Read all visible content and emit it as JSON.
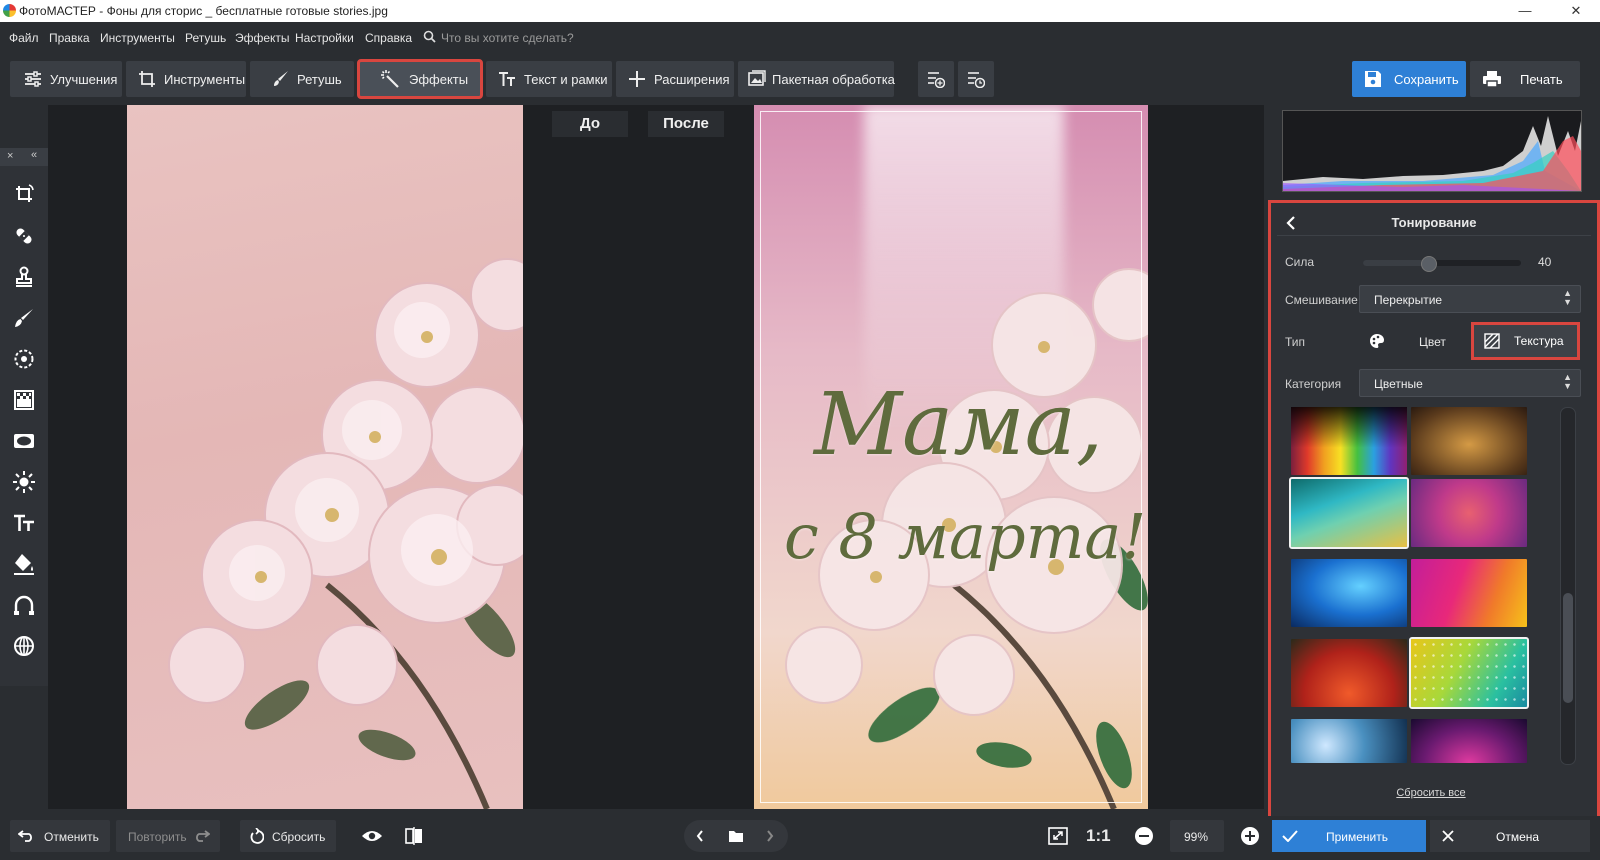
{
  "window": {
    "title": "ФотоМАСТЕР - Фоны для сторис _ бесплатные готовые stories.jpg",
    "min": "—",
    "max": "▢",
    "close": "✕"
  },
  "menu": {
    "items": [
      "Файл",
      "Правка",
      "Инструменты",
      "Ретушь",
      "Эффекты",
      "Настройки",
      "Справка"
    ],
    "search_placeholder": "Что вы хотите сделать?"
  },
  "toolbar": {
    "tabs": [
      {
        "label": "Улучшения",
        "icon": "sliders-icon"
      },
      {
        "label": "Инструменты",
        "icon": "crop-icon"
      },
      {
        "label": "Ретушь",
        "icon": "brush-icon"
      },
      {
        "label": "Эффекты",
        "icon": "magic-wand-icon",
        "active": true
      },
      {
        "label": "Текст и рамки",
        "icon": "text-icon"
      },
      {
        "label": "Расширения",
        "icon": "plus-icon"
      },
      {
        "label": "Пакетная обработка",
        "icon": "images-icon"
      }
    ],
    "save_label": "Сохранить",
    "print_label": "Печать"
  },
  "left_tools": {
    "close": "×",
    "collapse": "«"
  },
  "compare": {
    "before": "До",
    "after": "После"
  },
  "image_after": {
    "line1": "Мама,",
    "line2": "с 8 марта!"
  },
  "panel": {
    "title": "Тонирование",
    "strength_label": "Сила",
    "strength_value": "40",
    "strength": 40,
    "blend_label": "Смешивание",
    "blend_value": "Перекрытие",
    "type_label": "Тип",
    "type_color": "Цвет",
    "type_texture": "Текстура",
    "category_label": "Категория",
    "category_value": "Цветные",
    "reset_all": "Сбросить все"
  },
  "bottom": {
    "undo": "Отменить",
    "redo": "Повторить",
    "reset": "Сбросить",
    "zoom_ratio": "1:1",
    "zoom": "99%",
    "apply": "Применить",
    "cancel": "Отмена"
  },
  "colors": {
    "accent": "#2e80d6",
    "highlight": "#d9463f",
    "bg": "#2a2d31"
  }
}
